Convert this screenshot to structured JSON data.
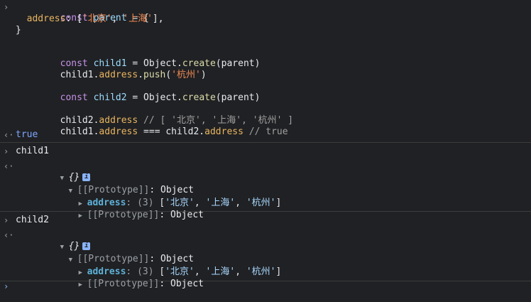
{
  "input_block": {
    "l1": {
      "kw": "const",
      "name": "parent",
      "rest": " = {"
    },
    "l2": {
      "prop": "address",
      "sep": ": [",
      "s1": "'北京'",
      "comma": ", ",
      "s2": "'上海'",
      "end": "],"
    },
    "l3": "}",
    "l5": {
      "kw": "const",
      "name": "child1",
      "eq": " = Object.",
      "fn": "create",
      "args": "(parent)"
    },
    "l6": {
      "obj": "child1.",
      "prop": "address",
      "dot": ".",
      "fn": "push",
      "open": "(",
      "str": "'杭州'",
      "close": ")"
    },
    "l8": {
      "kw": "const",
      "name": "child2",
      "eq": " = Object.",
      "fn": "create",
      "args": "(parent)"
    },
    "l10": {
      "obj": "child2.",
      "prop": "address",
      "comment": " // [ '北京', '上海', '杭州' ]"
    },
    "l11": {
      "obj": "child1.",
      "prop": "address",
      "op": " === child2.",
      "prop2": "address",
      "comment": " // true"
    },
    "result": "true"
  },
  "child1_block": {
    "input": "child1",
    "obj_label": "{}",
    "proto_label": "[[Prototype]]",
    "proto_value": ": Object",
    "address_key": "address",
    "address_count": ": (3) ",
    "address_open": "[",
    "v1": "'北京'",
    "v2": "'上海'",
    "v3": "'杭州'",
    "address_close": "]",
    "inner_proto_label": "[[Prototype]]",
    "inner_proto_value": ": Object"
  },
  "child2_block": {
    "input": "child2",
    "obj_label": "{}",
    "proto_label": "[[Prototype]]",
    "proto_value": ": Object",
    "address_key": "address",
    "address_count": ": (3) ",
    "address_open": "[",
    "v1": "'北京'",
    "v2": "'上海'",
    "v3": "'杭州'",
    "address_close": "]",
    "inner_proto_label": "[[Prototype]]",
    "inner_proto_value": ": Object"
  },
  "icons": {
    "input_prompt": "›",
    "output_prompt": "‹·",
    "expanded": "▼",
    "collapsed": "▶",
    "info": "i",
    "comma": ", "
  }
}
